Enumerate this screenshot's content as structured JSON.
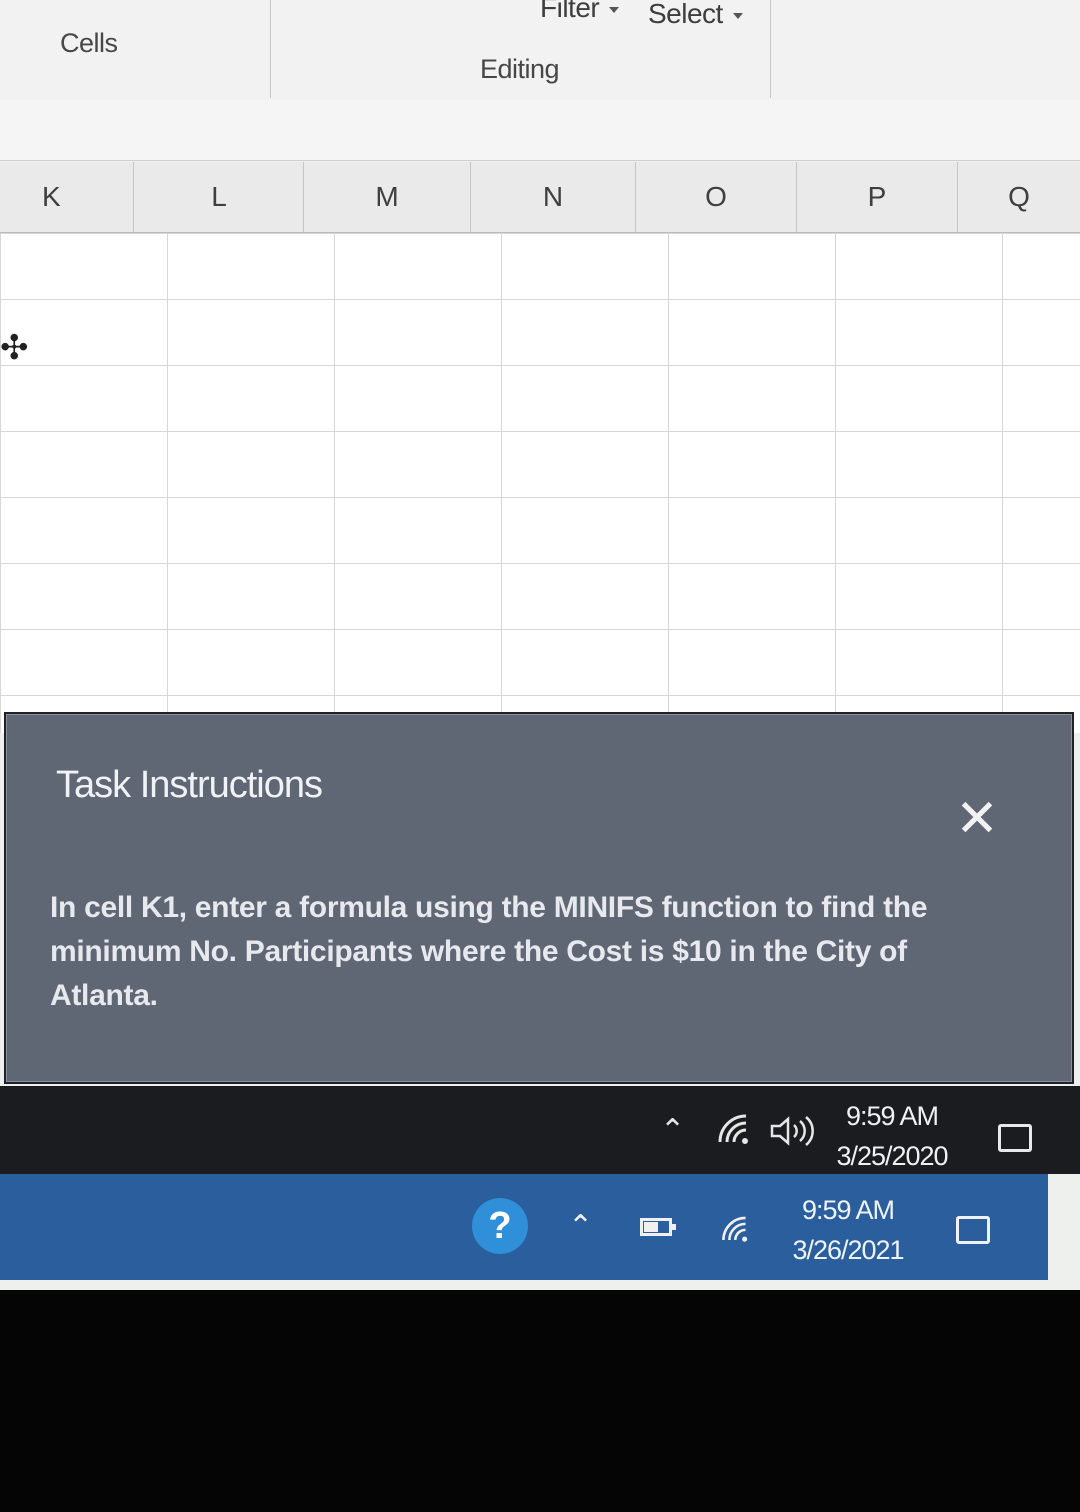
{
  "ribbon": {
    "filter_label": "Filter",
    "select_label": "Select",
    "cells_group": "Cells",
    "editing_group": "Editing"
  },
  "columns": [
    "K",
    "L",
    "M",
    "N",
    "O",
    "P",
    "Q"
  ],
  "task_panel": {
    "title": "Task Instructions",
    "close_glyph": "✕",
    "body": "In cell K1, enter a formula using the MINIFS function to find the minimum No. Participants where the Cost is $10 in the City of Atlanta."
  },
  "taskbar_inner": {
    "time": "9:59 AM",
    "date": "3/25/2020"
  },
  "taskbar_outer": {
    "help_glyph": "?",
    "time": "9:59 AM",
    "date": "3/26/2021",
    "battery_level": 0.6
  },
  "colors": {
    "panel_bg": "#5f6674",
    "taskbar_inner_bg": "#1b1c1f",
    "taskbar_outer_bg": "#2b5e9c"
  },
  "icons": {
    "cursor": "plus-cursor-icon",
    "tray_chevron": "chevron-up-icon",
    "wifi": "wifi-icon",
    "volume": "volume-icon",
    "notifications": "notification-icon"
  }
}
